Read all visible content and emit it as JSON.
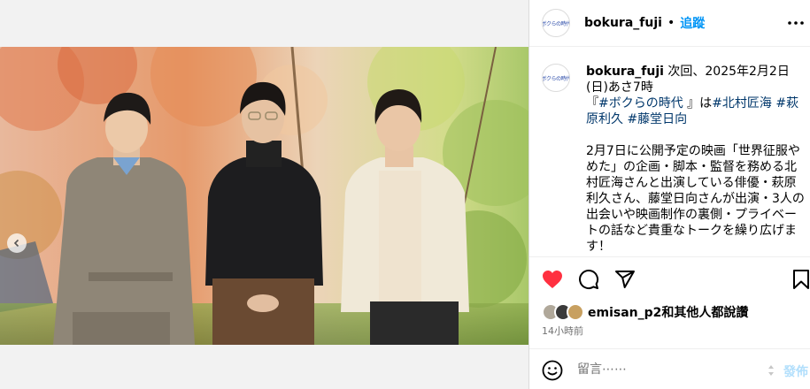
{
  "colors": {
    "link_blue": "#0095f6",
    "hashtag": "#00376b",
    "like_red": "#ff3040",
    "muted": "#737373"
  },
  "post": {
    "image_alt": "Three men standing in front of autumn foliage",
    "carousel": {
      "slide_count": 2,
      "current_index": 2
    }
  },
  "header": {
    "avatar_logo": "ボクらの時代",
    "username": "bokura_fuji",
    "separator": "•",
    "follow_label": "追蹤",
    "more_icon": "more-horizontal-icon"
  },
  "caption": {
    "username": "bokura_fuji",
    "line1_text": " 次回、2025年2月2日(日)あさ7時",
    "line2_prefix": "『",
    "hashtag_show": "#ボクらの時代",
    "line2_mid": " 』は",
    "hashtag_1": "#北村匠海",
    "hashtag_2": "#萩原利久",
    "hashtag_3": "#藤堂日向",
    "paragraph2": "2月7日に公開予定の映画「世界征服やめた」の企画・脚本・監督を務める北村匠海さんと出演している俳優・萩原利久さん、藤堂日向さんが出演・3人の出会いや映画制作の裏側・プライベートの話など貴重なトークを繰り広げます！"
  },
  "actions": {
    "like_icon": "heart-filled-icon",
    "comment_icon": "comment-icon",
    "share_icon": "send-icon",
    "save_icon": "bookmark-icon",
    "liked": true
  },
  "likes": {
    "user": "emisan_p2",
    "suffix": "和其他人都說讚"
  },
  "time_ago": "14小時前",
  "comment_box": {
    "placeholder": "留言⋯⋯",
    "post_label": "發佈"
  }
}
